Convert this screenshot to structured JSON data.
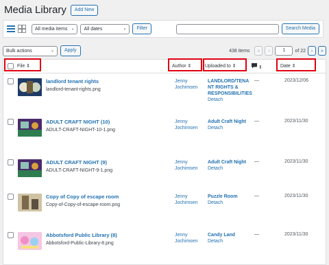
{
  "header": {
    "title": "Media Library",
    "add_new": "Add New"
  },
  "filters": {
    "type_select": "All media items",
    "date_select": "All dates",
    "filter_button": "Filter",
    "search_button": "Search Media",
    "search_value": ""
  },
  "tablenav": {
    "bulk_actions": "Bulk actions",
    "apply": "Apply",
    "items_count": "438 items",
    "current_page": "1",
    "of_pages": "of 22",
    "first": "«",
    "prev": "‹",
    "next": "›",
    "last": "»"
  },
  "columns": {
    "file": "File",
    "author": "Author",
    "uploaded_to": "Uploaded to",
    "date": "Date",
    "sort_icon": "⇕"
  },
  "rows": [
    {
      "title": "landlord tenant rights",
      "file": "landlord-tenant-rights.png",
      "author1": "Jenny",
      "author2": "Jochimsen",
      "up1": "LANDLORD/TENA",
      "up2": "NT RIGHTS &",
      "up3": "RESPONSIBILITIES",
      "detach": "Detach",
      "comments": "—",
      "date": "2023/12/06"
    },
    {
      "title": "ADULT CRAFT NIGHT (10)",
      "file": "ADULT-CRAFT-NIGHT-10-1.png",
      "author1": "Jenny",
      "author2": "Jochimsen",
      "up1": "Adult Craft Night",
      "up2": "",
      "up3": "",
      "detach": "Detach",
      "comments": "—",
      "date": "2023/11/30"
    },
    {
      "title": "ADULT CRAFT NIGHT (9)",
      "file": "ADULT-CRAFT-NIGHT-9-1.png",
      "author1": "Jenny",
      "author2": "Jochimsen",
      "up1": "Adult Craft Night",
      "up2": "",
      "up3": "",
      "detach": "Detach",
      "comments": "—",
      "date": "2023/11/30"
    },
    {
      "title": "Copy of Copy of escape room",
      "file": "Copy-of-Copy-of-escape-room.png",
      "author1": "Jenny",
      "author2": "Jochimsen",
      "up1": "Puzzle Room",
      "up2": "",
      "up3": "",
      "detach": "Detach",
      "comments": "—",
      "date": "2023/11/30"
    },
    {
      "title": "Abbotsford Public Library (8)",
      "file": "Abbotsford-Public-Library-8.png",
      "author1": "Jenny",
      "author2": "Jochimsen",
      "up1": "Candy Land",
      "up2": "",
      "up3": "",
      "detach": "Detach",
      "comments": "—",
      "date": "2023/11/30"
    }
  ],
  "colors": {
    "link": "#2271b1",
    "highlight": "#e0000f"
  }
}
